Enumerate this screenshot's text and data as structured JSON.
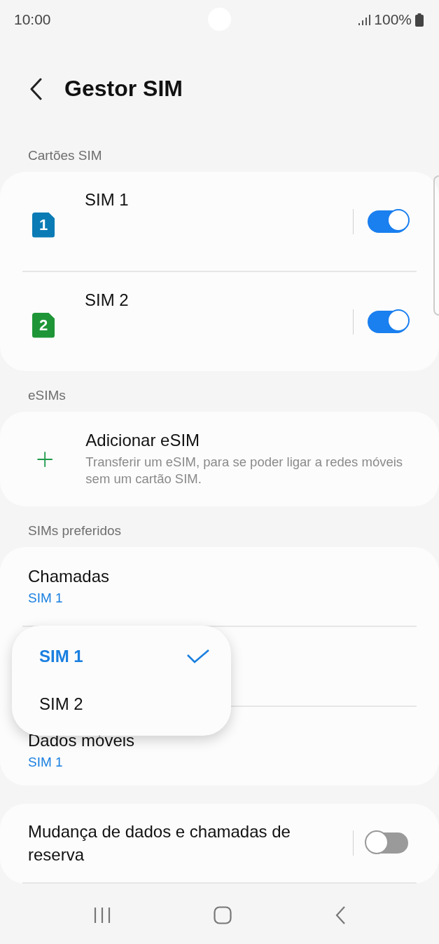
{
  "status_bar": {
    "time": "10:00",
    "battery": "100%"
  },
  "header": {
    "title": "Gestor SIM"
  },
  "sections": [
    {
      "label": "Cartões SIM",
      "kind": "sims",
      "items": [
        {
          "name": "SIM 1",
          "icon_label": "1",
          "color": "#0a7bb5",
          "on": true
        },
        {
          "name": "SIM 2",
          "icon_label": "2",
          "color": "#1e9637",
          "on": true
        }
      ]
    },
    {
      "label": "eSIMs",
      "kind": "add",
      "items": [
        {
          "title": "Adicionar eSIM",
          "description": "Transferir um eSIM, para se poder ligar a redes móveis sem um cartão SIM."
        }
      ]
    },
    {
      "label": "SIMs preferidos",
      "kind": "prefs",
      "items": [
        {
          "title": "Chamadas",
          "value": "SIM 1"
        },
        {
          "dropdown": {
            "options": [
              {
                "label": "SIM 1",
                "selected": true
              },
              {
                "label": "SIM 2",
                "selected": false
              }
            ]
          }
        },
        {
          "title": "Dados móveis",
          "value": "SIM 1"
        }
      ]
    },
    {
      "kind": "switches",
      "items": [
        {
          "title": "Mudança de dados e chamadas de reserva",
          "on": false
        }
      ]
    }
  ]
}
